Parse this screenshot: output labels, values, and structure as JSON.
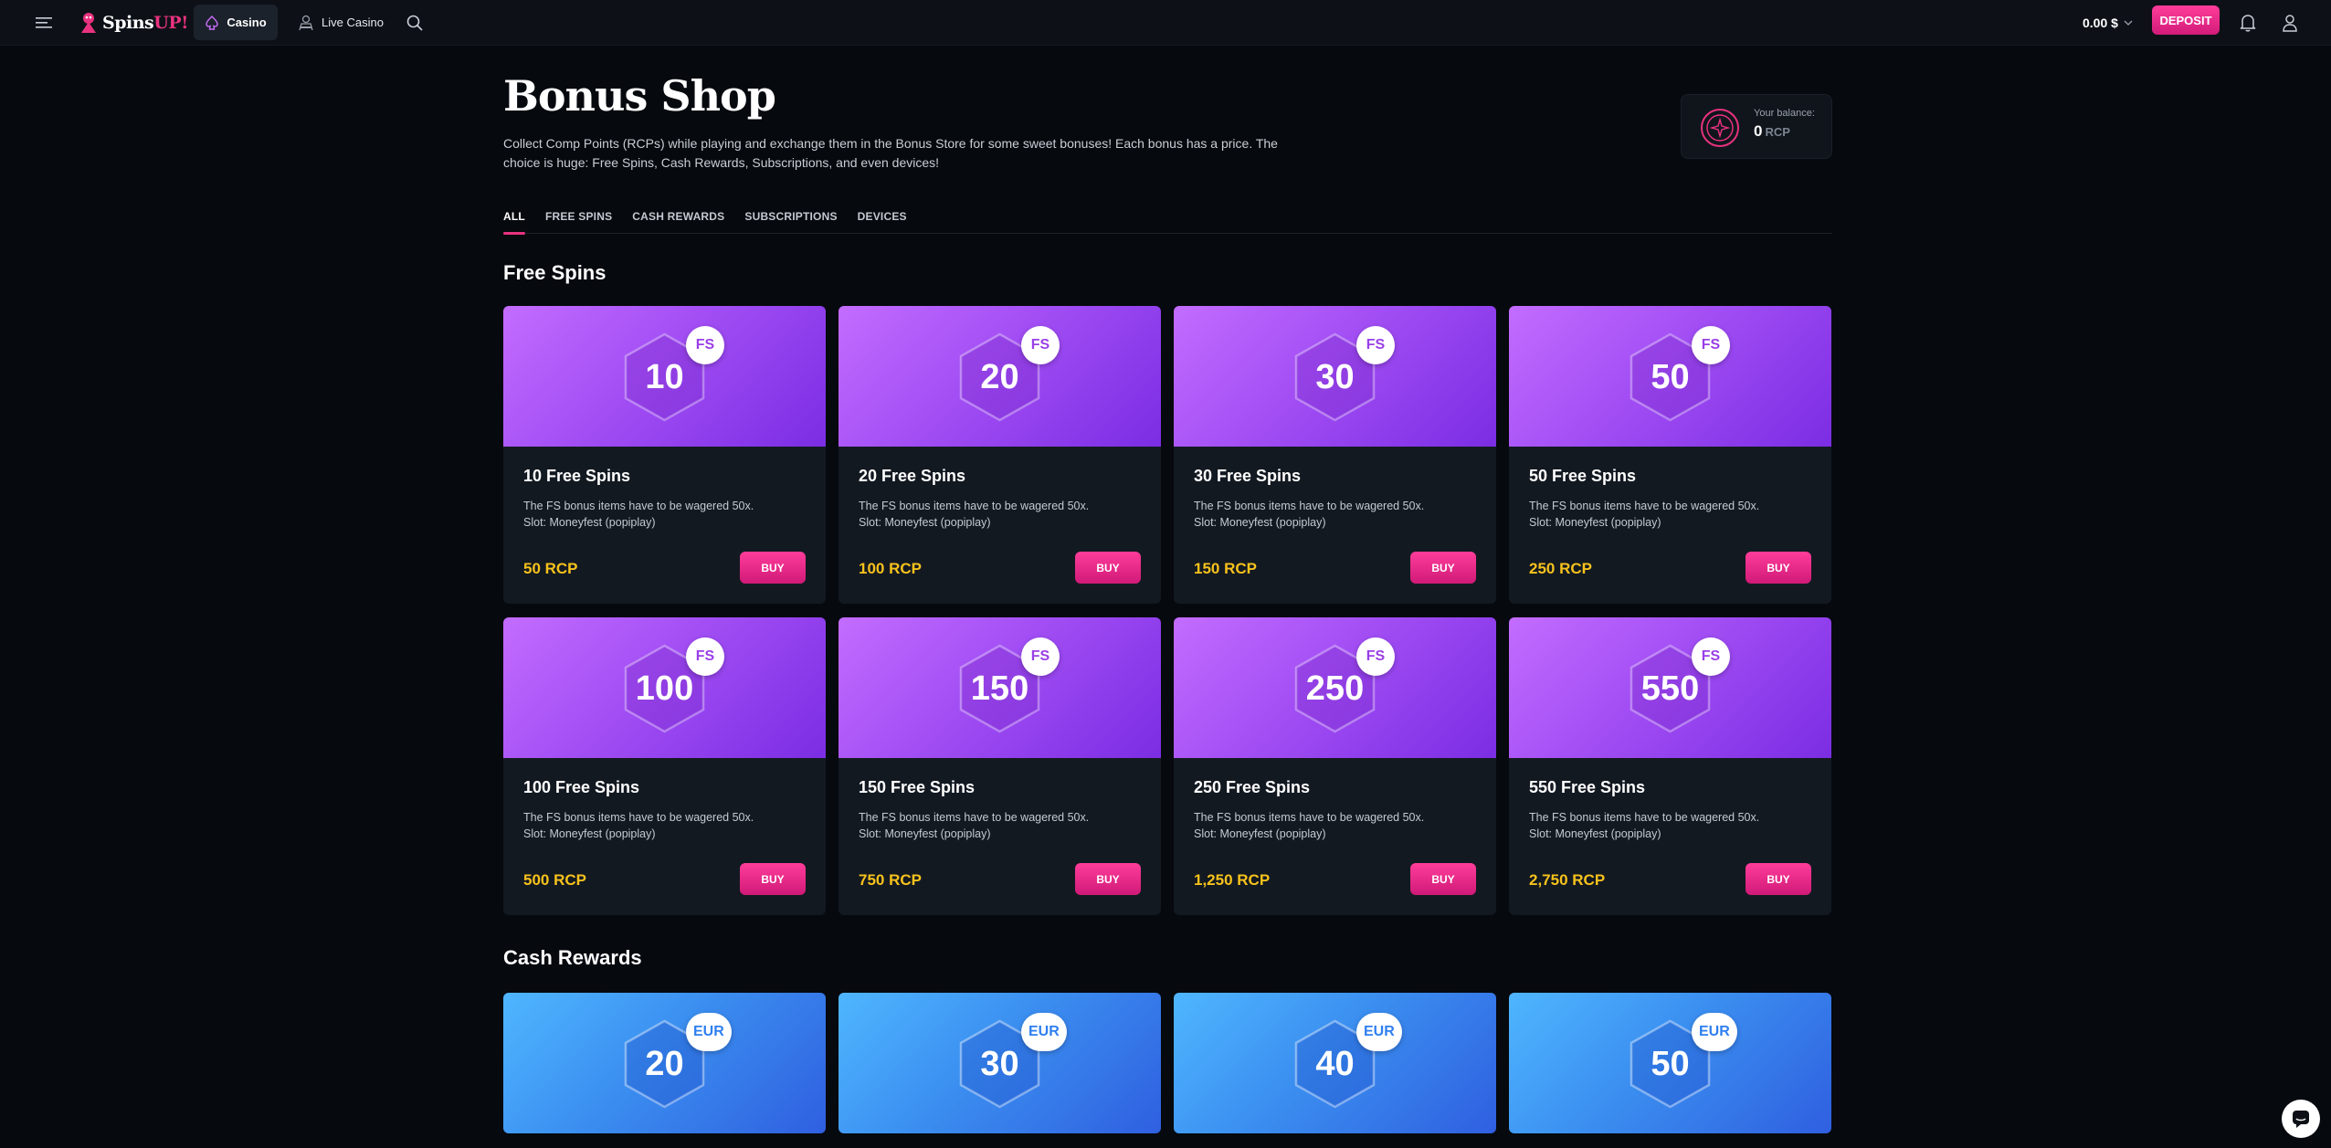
{
  "header": {
    "logo_main": "Spins",
    "logo_accent": "UP!",
    "nav_casino": "Casino",
    "nav_live": "Live Casino",
    "balance": "0.00 $",
    "deposit": "DEPOSIT"
  },
  "page": {
    "title": "Bonus Shop",
    "intro": "Collect Comp Points (RCPs) while playing and exchange them in the Bonus Store for some sweet bonuses! Each bonus has a price. The choice is huge: Free Spins, Cash Rewards, Subscriptions, and even devices!",
    "balance_label": "Your balance:",
    "balance_value": "0",
    "balance_unit": "RCP"
  },
  "tabs": [
    "ALL",
    "FREE SPINS",
    "CASH REWARDS",
    "SUBSCRIPTIONS",
    "DEVICES"
  ],
  "sections": {
    "free_spins": "Free Spins",
    "cash_rewards": "Cash Rewards"
  },
  "free_spins": [
    {
      "num": "10",
      "badge": "FS",
      "name": "10 Free Spins",
      "desc1": "The FS bonus items have to be wagered 50x.",
      "desc2": "Slot: Moneyfest (popiplay)",
      "price": "50 RCP",
      "buy": "BUY"
    },
    {
      "num": "20",
      "badge": "FS",
      "name": "20 Free Spins",
      "desc1": "The FS bonus items have to be wagered 50x.",
      "desc2": "Slot: Moneyfest (popiplay)",
      "price": "100 RCP",
      "buy": "BUY"
    },
    {
      "num": "30",
      "badge": "FS",
      "name": "30 Free Spins",
      "desc1": "The FS bonus items have to be wagered 50x.",
      "desc2": "Slot: Moneyfest (popiplay)",
      "price": "150 RCP",
      "buy": "BUY"
    },
    {
      "num": "50",
      "badge": "FS",
      "name": "50 Free Spins",
      "desc1": "The FS bonus items have to be wagered 50x.",
      "desc2": "Slot: Moneyfest (popiplay)",
      "price": "250 RCP",
      "buy": "BUY"
    },
    {
      "num": "100",
      "badge": "FS",
      "name": "100 Free Spins",
      "desc1": "The FS bonus items have to be wagered 50x.",
      "desc2": "Slot: Moneyfest (popiplay)",
      "price": "500 RCP",
      "buy": "BUY"
    },
    {
      "num": "150",
      "badge": "FS",
      "name": "150 Free Spins",
      "desc1": "The FS bonus items have to be wagered 50x.",
      "desc2": "Slot: Moneyfest (popiplay)",
      "price": "750 RCP",
      "buy": "BUY"
    },
    {
      "num": "250",
      "badge": "FS",
      "name": "250 Free Spins",
      "desc1": "The FS bonus items have to be wagered 50x.",
      "desc2": "Slot: Moneyfest (popiplay)",
      "price": "1,250 RCP",
      "buy": "BUY"
    },
    {
      "num": "550",
      "badge": "FS",
      "name": "550 Free Spins",
      "desc1": "The FS bonus items have to be wagered 50x.",
      "desc2": "Slot: Moneyfest (popiplay)",
      "price": "2,750 RCP",
      "buy": "BUY"
    }
  ],
  "cash_rewards": [
    {
      "num": "20",
      "badge": "EUR"
    },
    {
      "num": "30",
      "badge": "EUR"
    },
    {
      "num": "40",
      "badge": "EUR"
    },
    {
      "num": "50",
      "badge": "EUR"
    }
  ],
  "colors": {
    "accent": "#e8327f",
    "price": "#f7c21c",
    "background": "#06090e",
    "card": "#131921"
  }
}
